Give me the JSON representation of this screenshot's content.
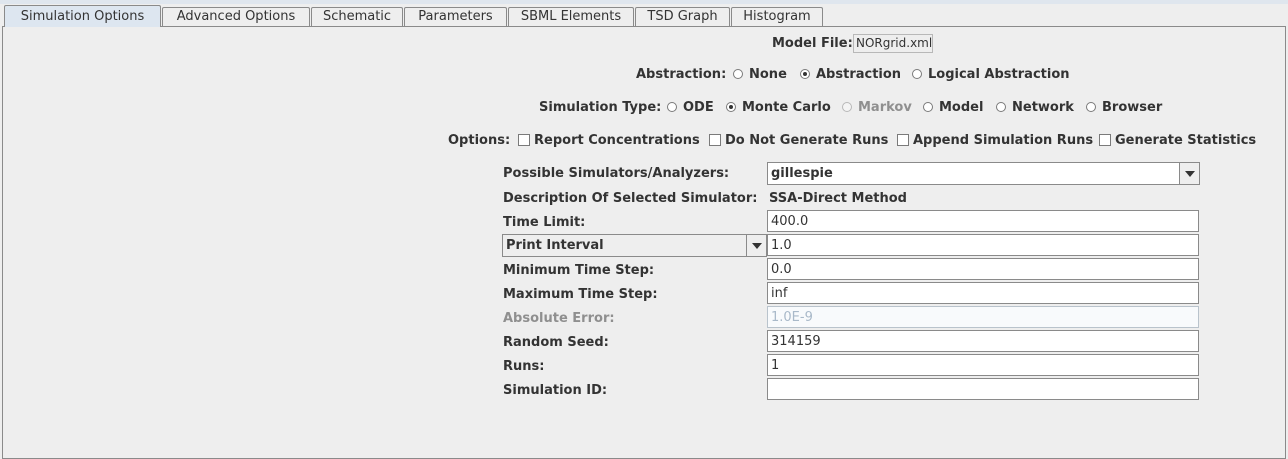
{
  "tabs": [
    {
      "label": "Simulation Options",
      "selected": true
    },
    {
      "label": "Advanced Options",
      "selected": false
    },
    {
      "label": "Schematic",
      "selected": false
    },
    {
      "label": "Parameters",
      "selected": false
    },
    {
      "label": "SBML Elements",
      "selected": false
    },
    {
      "label": "TSD Graph",
      "selected": false
    },
    {
      "label": "Histogram",
      "selected": false
    }
  ],
  "model_file": {
    "label": "Model File:",
    "value": "NORgrid.xml"
  },
  "abstraction": {
    "label": "Abstraction:",
    "options": [
      "None",
      "Abstraction",
      "Logical Abstraction"
    ],
    "selected": "Abstraction"
  },
  "simulation_type": {
    "label": "Simulation Type:",
    "options": [
      "ODE",
      "Monte Carlo",
      "Markov",
      "Model",
      "Network",
      "Browser"
    ],
    "selected": "Monte Carlo",
    "disabled": [
      "Markov"
    ]
  },
  "options": {
    "label": "Options:",
    "checkboxes": [
      {
        "label": "Report Concentrations",
        "checked": false
      },
      {
        "label": "Do Not Generate Runs",
        "checked": false
      },
      {
        "label": "Append Simulation Runs",
        "checked": false
      },
      {
        "label": "Generate Statistics",
        "checked": false
      }
    ]
  },
  "form": {
    "simulators_label": "Possible Simulators/Analyzers:",
    "simulator_value": "gillespie",
    "description_label": "Description Of Selected Simulator:",
    "description_value": "SSA-Direct Method",
    "time_limit_label": "Time Limit:",
    "time_limit_value": "400.0",
    "interval_select": "Print Interval",
    "interval_value": "1.0",
    "min_step_label": "Minimum Time Step:",
    "min_step_value": "0.0",
    "max_step_label": "Maximum Time Step:",
    "max_step_value": "inf",
    "abs_error_label": "Absolute Error:",
    "abs_error_value": "1.0E-9",
    "seed_label": "Random Seed:",
    "seed_value": "314159",
    "runs_label": "Runs:",
    "runs_value": "1",
    "sim_id_label": "Simulation ID:",
    "sim_id_value": ""
  }
}
